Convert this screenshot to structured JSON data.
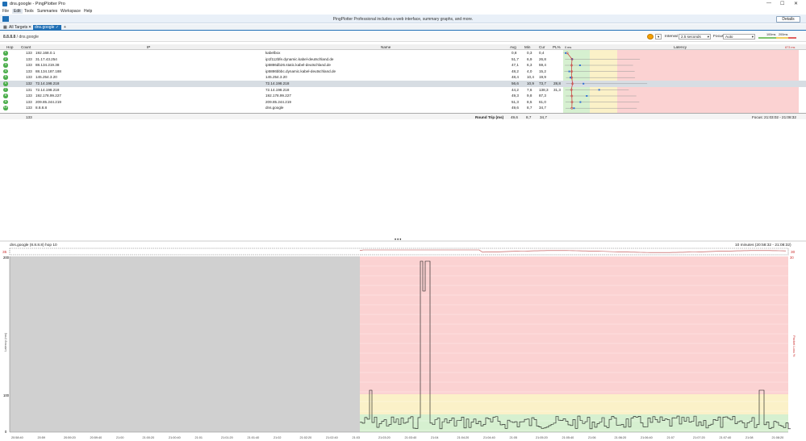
{
  "window": {
    "title": "dns.google - PingPlotter Pro",
    "minimize": "—",
    "maximize": "☐",
    "close": "✕"
  },
  "menu": [
    "File",
    "Edit",
    "Tools",
    "Summaries",
    "Workspace",
    "Help"
  ],
  "banner": {
    "message": "PingPlotter Professional includes a web interface, summary graphs, and more.",
    "details_label": "Details"
  },
  "tabs": {
    "all_targets": "All Targets",
    "active": "dns.google",
    "add": "+"
  },
  "toolbar": {
    "breadcrumb_ip": "8.8.8.8",
    "breadcrumb_sep": " / ",
    "breadcrumb_host": "dns.google",
    "interval_label": "Interval",
    "interval_value": "2.5 seconds",
    "focus_label": "Focus",
    "focus_value": "Auto",
    "legend_low": "100ms",
    "legend_high": "200ms"
  },
  "grid": {
    "headers": {
      "hop": "Hop",
      "count": "Count",
      "ip": "IP",
      "name": "Name",
      "avg": "Avg",
      "min": "Min",
      "cur": "Cur",
      "pl": "PL%",
      "latency": "Latency"
    },
    "latency_axis_min": "0 ms",
    "latency_axis_max": "873 ms",
    "rows": [
      {
        "hop": "1",
        "count": "133",
        "ip": "192.168.0.1",
        "name": "kabelbox",
        "avg": "0,8",
        "min": "0,3",
        "cur": "0,4",
        "pl": ""
      },
      {
        "hop": "2",
        "count": "133",
        "ip": "31.17.43.254",
        "name": "ip1f112bfe.dynamic.kabel-deutschland.de",
        "avg": "51,7",
        "min": "6,9",
        "cur": "26,8",
        "pl": ""
      },
      {
        "hop": "3",
        "count": "133",
        "ip": "88.134.219.38",
        "name": "ip5886db26.static.kabel-deutschland.de",
        "avg": "47,1",
        "min": "6,3",
        "cur": "59,4",
        "pl": ""
      },
      {
        "hop": "4",
        "count": "133",
        "ip": "88.134.187.188",
        "name": "ip5886bbbc.dynamic.kabel-deutschland.de",
        "avg": "48,2",
        "min": "4,0",
        "cur": "15,2",
        "pl": ""
      },
      {
        "hop": "5",
        "count": "133",
        "ip": "145.254.3.20",
        "name": "145.254.3.20",
        "avg": "48,4",
        "min": "10,4",
        "cur": "19,9",
        "pl": ""
      },
      {
        "hop": "6",
        "count": "132",
        "ip": "72.14.198.218",
        "name": "72.14.198.218",
        "avg": "56,6",
        "min": "10,9",
        "cur": "73,7",
        "pl": "28,8"
      },
      {
        "hop": "7",
        "count": "131",
        "ip": "72.14.198.218",
        "name": "72.14.198.218",
        "avg": "44,2",
        "min": "7,6",
        "cur": "138,3",
        "pl": "31,3"
      },
      {
        "hop": "8",
        "count": "133",
        "ip": "192.178.99.227",
        "name": "192.178.99.227",
        "avg": "49,3",
        "min": "9,8",
        "cur": "87,3",
        "pl": ""
      },
      {
        "hop": "9",
        "count": "133",
        "ip": "209.85.244.219",
        "name": "209.85.244.219",
        "avg": "51,3",
        "min": "8,5",
        "cur": "61,0",
        "pl": ""
      },
      {
        "hop": "10",
        "count": "133",
        "ip": "8.8.8.8",
        "name": "dns.google",
        "avg": "49,6",
        "min": "8,7",
        "cur": "34,7",
        "pl": ""
      }
    ],
    "footer": {
      "count": "133",
      "label": "Round Trip (ms)",
      "avg": "49,6",
      "min": "8,7",
      "cur": "34,7",
      "focus": "Focus: 21:03:02 - 21:08:32"
    }
  },
  "lower": {
    "title": "dns.google (8.8.8.8) hop 10",
    "range": "10 minutes (20:58:32 - 21:08:32)",
    "mini_left": "35",
    "mini_right": "30",
    "y_axis_label": "Latency (ms)",
    "y_axis_right_label": "Packet Loss %",
    "y_ticks": [
      "200",
      "100",
      "0"
    ],
    "time_labels": [
      "20:58:40",
      "20:59",
      "20:59:20",
      "20:59:40",
      "21:00",
      "21:00:20",
      "21:00:40",
      "21:01",
      "21:01:20",
      "21:01:40",
      "21:02",
      "21:02:20",
      "21:02:40",
      "21:03",
      "21:03:20",
      "21:03:40",
      "21:04",
      "21:04:20",
      "21:04:40",
      "21:05",
      "21:05:20",
      "21:05:40",
      "21:06",
      "21:06:20",
      "21:06:40",
      "21:07",
      "21:07:20",
      "21:07:40",
      "21:08",
      "21:08:20"
    ],
    "focus_start_label": "21:03",
    "right_top_value": "30"
  },
  "colors": {
    "accent": "#1f6fb5",
    "good": "#d6f0d0",
    "warn": "#fbf1c8",
    "bad": "#fbd2d2",
    "shaded": "#d0d0d0",
    "hop_ok": "#4cae4c"
  }
}
